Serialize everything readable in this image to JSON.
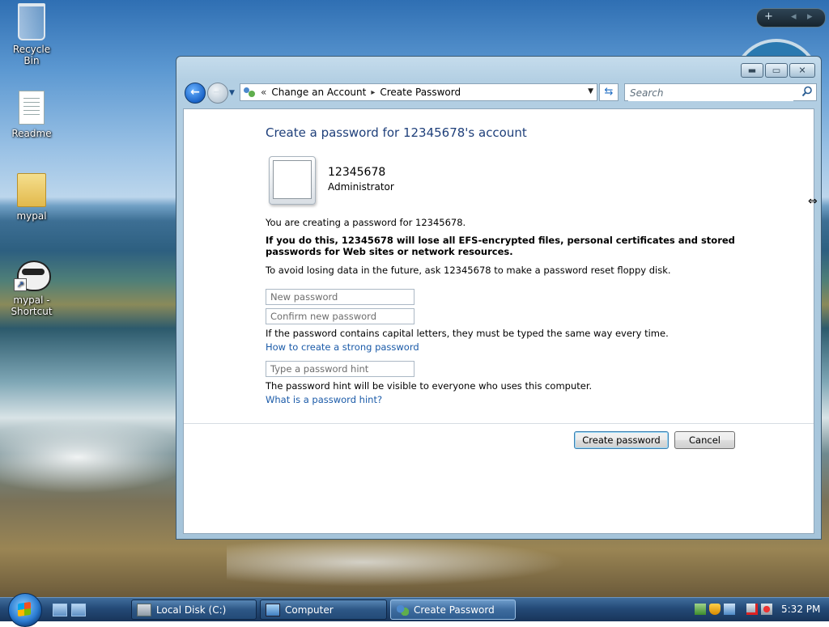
{
  "desktop": {
    "icons": [
      {
        "label": "Recycle Bin",
        "icon": "recycle-bin-icon"
      },
      {
        "label": "Readme",
        "icon": "text-document-icon"
      },
      {
        "label": "mypal",
        "icon": "folder-icon"
      },
      {
        "label": "mypal - Shortcut",
        "icon": "raccoon-shortcut-icon"
      }
    ],
    "gadget_controls": {
      "add": "+",
      "prev": "◂",
      "next": "▸"
    }
  },
  "window": {
    "controls": {
      "minimize": "▬",
      "maximize": "▭",
      "close": "✕"
    },
    "nav": {
      "back": "←",
      "forward": "→",
      "recent": "▼"
    },
    "address": {
      "prefix": "«",
      "breadcrumbs": [
        "Change an Account",
        "Create Password"
      ],
      "separator": "▸",
      "dropdown": "▼"
    },
    "refresh": "⇆",
    "search": {
      "placeholder": "Search"
    }
  },
  "page": {
    "title": "Create a password for 12345678's account",
    "user": {
      "name": "12345678",
      "type": "Administrator"
    },
    "intro": "You are creating a password for 12345678.",
    "warning": "If you do this, 12345678 will lose all EFS-encrypted files, personal certificates and stored passwords for Web sites or network resources.",
    "advice": "To avoid losing data in the future, ask 12345678 to make a password reset floppy disk.",
    "new_password": {
      "value": "",
      "placeholder": "New password"
    },
    "confirm_password": {
      "value": "",
      "placeholder": "Confirm new password"
    },
    "case_note": "If the password contains capital letters, they must be typed the same way every time.",
    "strong_link": "How to create a strong password",
    "hint": {
      "value": "",
      "placeholder": "Type a password hint"
    },
    "hint_note": "The password hint will be visible to everyone who uses this computer.",
    "hint_link": "What is a password hint?",
    "buttons": {
      "create": "Create password",
      "cancel": "Cancel"
    }
  },
  "cursor": {
    "icon": "resize-horizontal-cursor",
    "glyph": "⇔"
  },
  "taskbar": {
    "quick_launch": [
      "show-desktop-icon",
      "switch-windows-icon"
    ],
    "tasks": [
      {
        "label": "Local Disk (C:)",
        "icon": "drive-icon",
        "active": false
      },
      {
        "label": "Computer",
        "icon": "computer-icon",
        "active": false
      },
      {
        "label": "Create Password",
        "icon": "user-accounts-icon",
        "active": true
      }
    ],
    "tray_icons": [
      "security-center-icon",
      "shield-warning-icon",
      "network-icon",
      "network-disconnected-icon",
      "volume-muted-icon"
    ],
    "clock": "5:32 PM"
  },
  "colors": {
    "title_blue": "#1e3f7a",
    "link_blue": "#1a5aa8",
    "taskbar": "#244a77",
    "window_frame": "#b3cfe3"
  }
}
